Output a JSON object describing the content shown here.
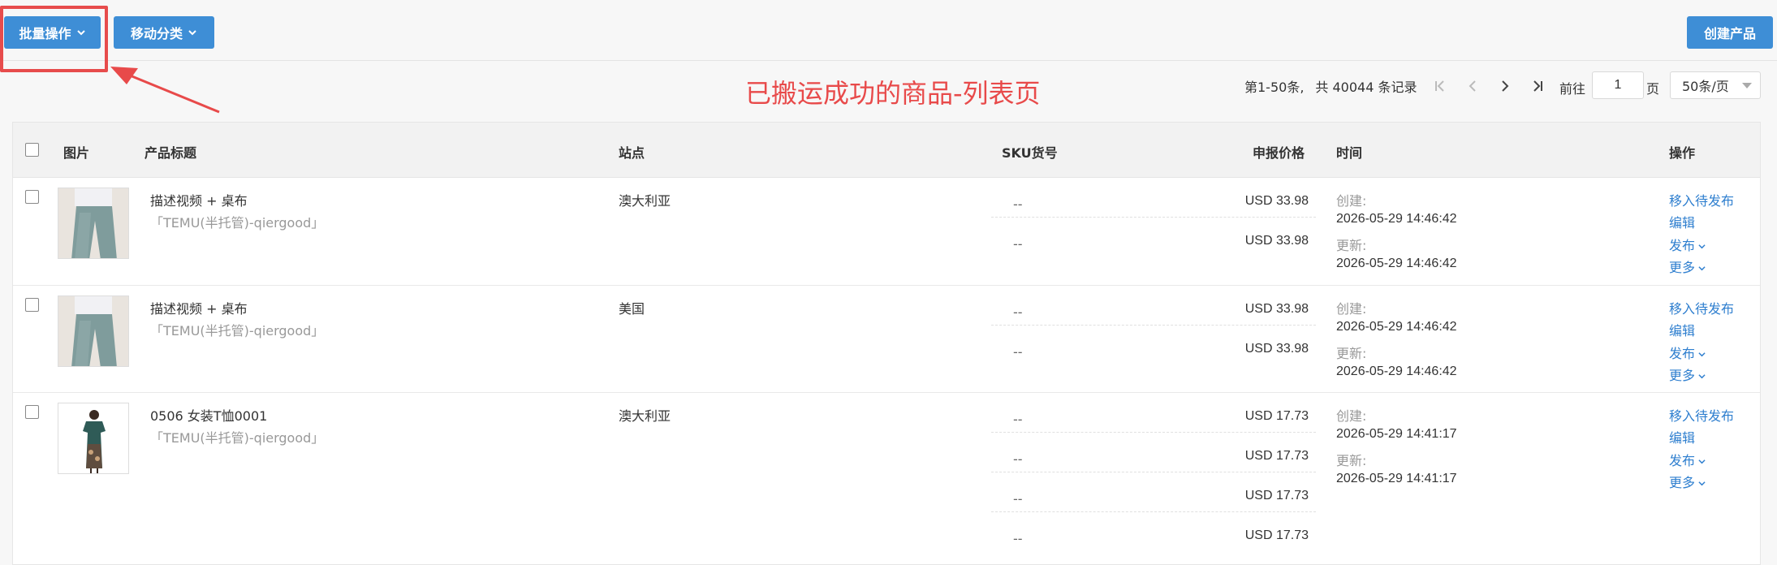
{
  "toolbar": {
    "batch_label": "批量操作",
    "move_label": "移动分类",
    "create_label": "创建产品"
  },
  "annotation": "已搬运成功的商品-列表页",
  "pager": {
    "range": "第1-50条,",
    "total": "共 40044 条记录",
    "goto_label": "前往",
    "page_value": "1",
    "page_unit": "页",
    "page_size": "50条/页"
  },
  "table": {
    "headers": {
      "image": "图片",
      "title": "产品标题",
      "site": "站点",
      "sku": "SKU货号",
      "price": "申报价格",
      "time": "时间",
      "actions": "操作"
    },
    "rows": [
      {
        "title": "描述视频 + 桌布",
        "store": "「TEMU(半托管)-qiergood」",
        "site": "澳大利亚",
        "skus": [
          {
            "sku": "--",
            "price": "USD 33.98"
          },
          {
            "sku": "--",
            "price": "USD 33.98"
          }
        ],
        "created_label": "创建:",
        "created": "2026-05-29 14:46:42",
        "updated_label": "更新:",
        "updated": "2026-05-29 14:46:42",
        "ops": {
          "move": "移入待发布",
          "edit": "编辑",
          "publish": "发布",
          "more": "更多"
        }
      },
      {
        "title": "描述视频 + 桌布",
        "store": "「TEMU(半托管)-qiergood」",
        "site": "美国",
        "skus": [
          {
            "sku": "--",
            "price": "USD 33.98"
          },
          {
            "sku": "--",
            "price": "USD 33.98"
          }
        ],
        "created_label": "创建:",
        "created": "2026-05-29 14:46:42",
        "updated_label": "更新:",
        "updated": "2026-05-29 14:46:42",
        "ops": {
          "move": "移入待发布",
          "edit": "编辑",
          "publish": "发布",
          "more": "更多"
        }
      },
      {
        "title": "0506 女装T恤0001",
        "store": "「TEMU(半托管)-qiergood」",
        "site": "澳大利亚",
        "skus": [
          {
            "sku": "--",
            "price": "USD 17.73"
          },
          {
            "sku": "--",
            "price": "USD 17.73"
          },
          {
            "sku": "--",
            "price": "USD 17.73"
          },
          {
            "sku": "--",
            "price": "USD 17.73"
          }
        ],
        "created_label": "创建:",
        "created": "2026-05-29 14:41:17",
        "updated_label": "更新:",
        "updated": "2026-05-29 14:41:17",
        "ops": {
          "move": "移入待发布",
          "edit": "编辑",
          "publish": "发布",
          "more": "更多"
        }
      }
    ]
  },
  "colors": {
    "primary": "#3e8ed6",
    "link": "#2f7fcf",
    "annotation": "#e84a4a"
  }
}
